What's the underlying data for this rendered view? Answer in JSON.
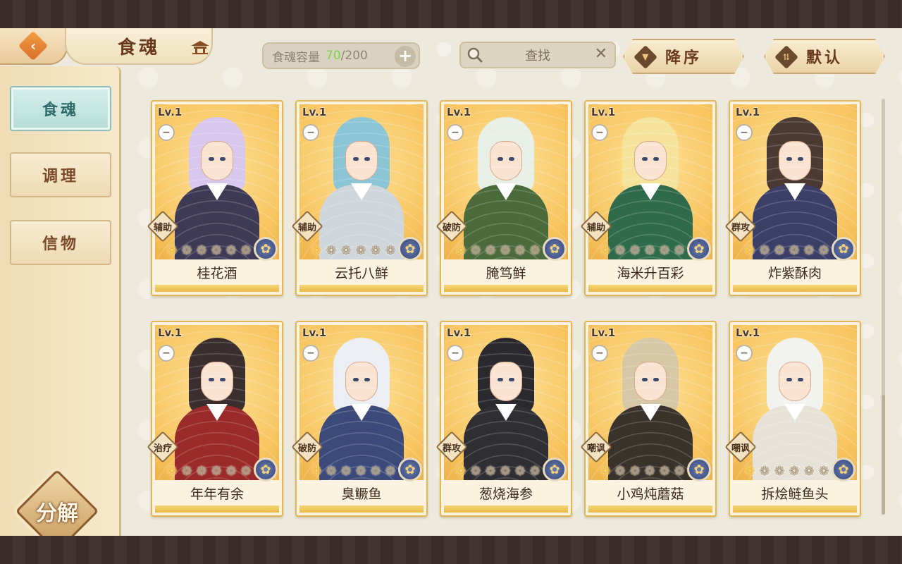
{
  "header": {
    "back_icon": "chevron-left-icon",
    "title": "食魂",
    "title_ornament_icon": "pavilion-icon",
    "capacity": {
      "label": "食魂容量",
      "current": "70",
      "separator": "/",
      "max": "200",
      "plus": "+"
    },
    "search": {
      "label": "查找",
      "icon": "search-icon",
      "clear": "✕"
    },
    "sort_desc": {
      "label": "降序",
      "icon": "triangle-down-icon"
    },
    "sort_default": {
      "label": "默认",
      "icon": "sort-toggle-icon"
    }
  },
  "sidebar": {
    "tabs": [
      {
        "label": "食魂",
        "active": true
      },
      {
        "label": "调理",
        "active": false
      },
      {
        "label": "信物",
        "active": false
      }
    ],
    "decompose_label": "分解"
  },
  "colors": {
    "accent_orange": "#d96d2a",
    "active_tab": "#b6dcd6",
    "capacity_current": "#7dd34a",
    "card_border": "#e0b657"
  },
  "cards": [
    {
      "level": "Lv.1",
      "role": "辅助",
      "name": "桂花酒",
      "stars_lit": 1,
      "stars_total": 6,
      "elem_icon": "flower-emblem-icon",
      "hair": "#d9c8ee",
      "outfit": "#3e3a55"
    },
    {
      "level": "Lv.1",
      "role": "辅助",
      "name": "云托八鲜",
      "stars_lit": 1,
      "stars_total": 6,
      "elem_icon": "flower-emblem-icon",
      "hair": "#8cc6d6",
      "outfit": "#cfd6dc"
    },
    {
      "level": "Lv.1",
      "role": "破防",
      "name": "腌笃鲜",
      "stars_lit": 1,
      "stars_total": 6,
      "elem_icon": "flower-emblem-icon",
      "hair": "#e8efe6",
      "outfit": "#4b6a3c"
    },
    {
      "level": "Lv.1",
      "role": "辅助",
      "name": "海米升百彩",
      "stars_lit": 1,
      "stars_total": 6,
      "elem_icon": "flower-emblem-icon",
      "hair": "#f6e39b",
      "outfit": "#2f6a4a"
    },
    {
      "level": "Lv.1",
      "role": "群攻",
      "name": "炸紫酥肉",
      "stars_lit": 1,
      "stars_total": 6,
      "elem_icon": "flower-emblem-icon",
      "hair": "#4a3a32",
      "outfit": "#3b3f66"
    },
    {
      "level": "Lv.1",
      "role": "治疗",
      "name": "年年有余",
      "stars_lit": 1,
      "stars_total": 6,
      "elem_icon": "flower-emblem-icon",
      "hair": "#3a2e2e",
      "outfit": "#9b2a2a"
    },
    {
      "level": "Lv.1",
      "role": "破防",
      "name": "臭鳜鱼",
      "stars_lit": 1,
      "stars_total": 6,
      "elem_icon": "flower-emblem-icon",
      "hair": "#ebeef2",
      "outfit": "#3c4a7a"
    },
    {
      "level": "Lv.1",
      "role": "群攻",
      "name": "葱烧海参",
      "stars_lit": 1,
      "stars_total": 6,
      "elem_icon": "flower-emblem-icon",
      "hair": "#2a2a2e",
      "outfit": "#2e2e33"
    },
    {
      "level": "Lv.1",
      "role": "嘲讽",
      "name": "小鸡炖蘑菇",
      "stars_lit": 1,
      "stars_total": 6,
      "elem_icon": "flower-emblem-icon",
      "hair": "#d6c8a6",
      "outfit": "#3a332c"
    },
    {
      "level": "Lv.1",
      "role": "嘲讽",
      "name": "拆烩鲢鱼头",
      "stars_lit": 1,
      "stars_total": 6,
      "elem_icon": "flower-emblem-icon",
      "hair": "#f2f2ef",
      "outfit": "#e6e2d8"
    }
  ]
}
